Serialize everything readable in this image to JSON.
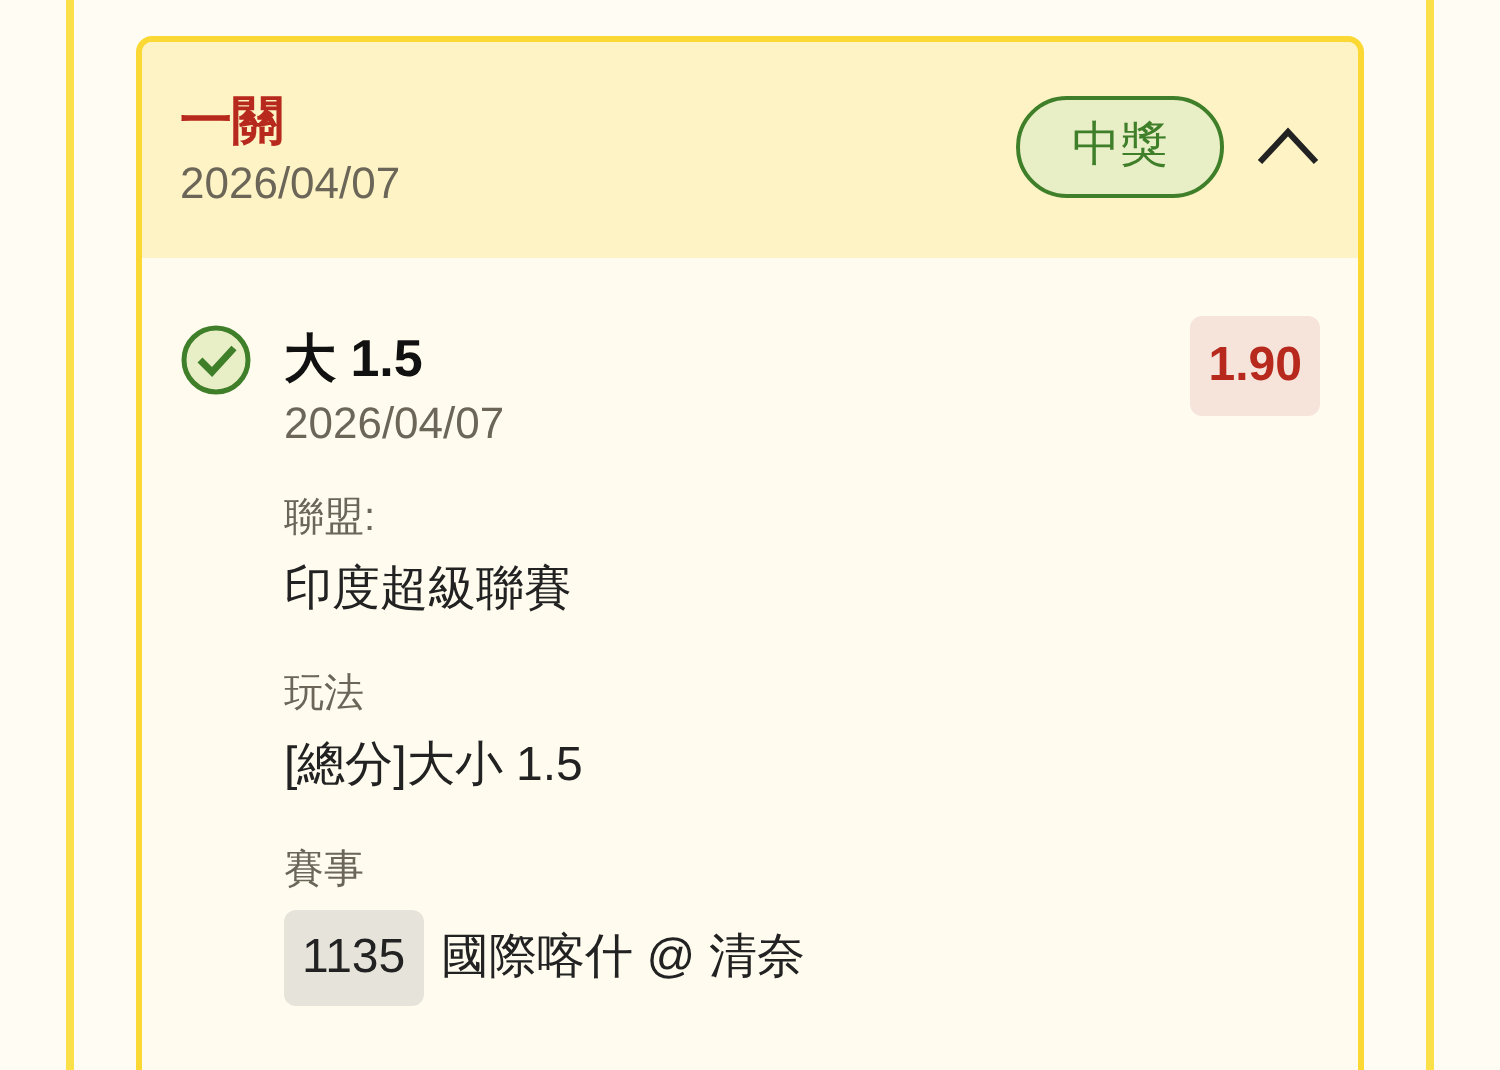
{
  "bet": {
    "title": "一關",
    "date": "2026/04/07",
    "status": {
      "label": "中獎",
      "kind": "won"
    },
    "expanded": true
  },
  "legs": [
    {
      "won": true,
      "selection": "大 1.5",
      "date": "2026/04/07",
      "odds": "1.90",
      "fields": [
        {
          "label": "聯盟:",
          "value": "印度超級聯賽"
        },
        {
          "label": "玩法",
          "value": "[總分]大小 1.5"
        },
        {
          "label": "賽事",
          "code": "1135",
          "value": "國際喀什 @ 清奈"
        }
      ]
    }
  ]
}
